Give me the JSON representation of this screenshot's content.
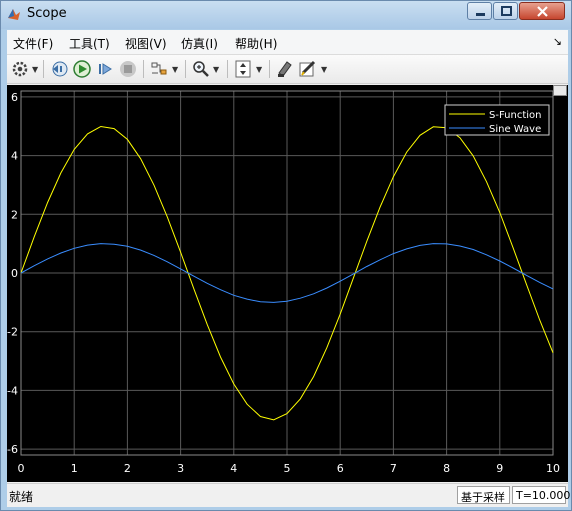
{
  "window": {
    "title": "Scope"
  },
  "menu": {
    "items": [
      "文件(F)",
      "工具(T)",
      "视图(V)",
      "仿真(I)",
      "帮助(H)"
    ],
    "overflow_arrow": "↘"
  },
  "toolbar": {
    "icons": [
      "gear-icon",
      "step-back-icon",
      "run-icon",
      "step-forward-icon",
      "stop-icon",
      "signal-select-icon",
      "zoom-in-icon",
      "autoscale-icon",
      "highlight-icon",
      "style-icon"
    ]
  },
  "status": {
    "left_text": "就绪",
    "sample_mode": "基于采样",
    "time": "T=10.000"
  },
  "colors": {
    "plot_background": "#000000",
    "grid": "#5a5a5a",
    "axis_text": "#ffffff",
    "s_function": "#ffff00",
    "sine_wave": "#3a8dff"
  },
  "chart_data": {
    "type": "line",
    "title": "",
    "xlabel": "",
    "ylabel": "",
    "xlim": [
      0,
      10
    ],
    "ylim": [
      -6.2,
      6.2
    ],
    "x_ticks": [
      "0",
      "1",
      "2",
      "3",
      "4",
      "5",
      "6",
      "7",
      "8",
      "9",
      "10"
    ],
    "y_ticks": [
      "6",
      "4",
      "2",
      "0",
      "-2",
      "-4",
      "-6"
    ],
    "y_tick_values": [
      6,
      4,
      2,
      0,
      -2,
      -4,
      -6
    ],
    "x_tick_values": [
      0,
      1,
      2,
      3,
      4,
      5,
      6,
      7,
      8,
      9,
      10
    ],
    "grid": true,
    "legend_position": "top-right",
    "series": [
      {
        "name": "S-Function",
        "color": "#ffff00",
        "x": [
          0,
          0.25,
          0.5,
          0.75,
          1,
          1.25,
          1.5,
          1.75,
          2,
          2.25,
          2.5,
          2.75,
          3,
          3.25,
          3.5,
          3.75,
          4,
          4.25,
          4.5,
          4.75,
          5,
          5.25,
          5.5,
          5.75,
          6,
          6.25,
          6.5,
          6.75,
          7,
          7.25,
          7.5,
          7.75,
          8,
          8.25,
          8.5,
          8.75,
          9,
          9.25,
          9.5,
          9.75,
          10
        ],
        "y": [
          0,
          1.24,
          2.4,
          3.41,
          4.21,
          4.74,
          4.99,
          4.92,
          4.55,
          3.89,
          2.99,
          1.91,
          0.71,
          -0.54,
          -1.75,
          -2.86,
          -3.78,
          -4.47,
          -4.89,
          -5.0,
          -4.79,
          -4.29,
          -3.53,
          -2.54,
          -1.4,
          -0.16,
          1.08,
          2.25,
          3.28,
          4.12,
          4.69,
          4.98,
          4.95,
          4.61,
          3.99,
          3.11,
          2.06,
          0.86,
          -0.38,
          -1.6,
          -2.72
        ]
      },
      {
        "name": "Sine Wave",
        "color": "#3a8dff",
        "x": [
          0,
          0.25,
          0.5,
          0.75,
          1,
          1.25,
          1.5,
          1.75,
          2,
          2.25,
          2.5,
          2.75,
          3,
          3.25,
          3.5,
          3.75,
          4,
          4.25,
          4.5,
          4.75,
          5,
          5.25,
          5.5,
          5.75,
          6,
          6.25,
          6.5,
          6.75,
          7,
          7.25,
          7.5,
          7.75,
          8,
          8.25,
          8.5,
          8.75,
          9,
          9.25,
          9.5,
          9.75,
          10
        ],
        "y": [
          0,
          0.25,
          0.48,
          0.68,
          0.84,
          0.95,
          1.0,
          0.98,
          0.91,
          0.78,
          0.6,
          0.38,
          0.14,
          -0.11,
          -0.35,
          -0.57,
          -0.76,
          -0.89,
          -0.98,
          -1.0,
          -0.96,
          -0.86,
          -0.71,
          -0.51,
          -0.28,
          -0.03,
          0.22,
          0.45,
          0.66,
          0.82,
          0.94,
          1.0,
          0.99,
          0.92,
          0.8,
          0.62,
          0.41,
          0.17,
          -0.08,
          -0.32,
          -0.54
        ]
      }
    ]
  }
}
